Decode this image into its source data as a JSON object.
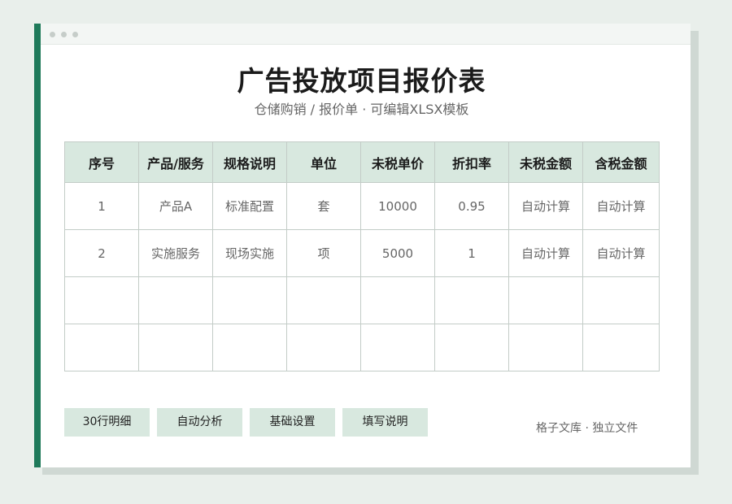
{
  "document": {
    "title": "广告投放项目报价表",
    "subtitle": "仓储购销 / 报价单 · 可编辑XLSX模板"
  },
  "table": {
    "headers": [
      "序号",
      "产品/服务",
      "规格说明",
      "单位",
      "未税单价",
      "折扣率",
      "未税金额",
      "含税金额"
    ],
    "rows": [
      [
        "1",
        "产品A",
        "标准配置",
        "套",
        "10000",
        "0.95",
        "自动计算",
        "自动计算"
      ],
      [
        "2",
        "实施服务",
        "现场实施",
        "项",
        "5000",
        "1",
        "自动计算",
        "自动计算"
      ],
      [
        "",
        "",
        "",
        "",
        "",
        "",
        "",
        ""
      ],
      [
        "",
        "",
        "",
        "",
        "",
        "",
        "",
        ""
      ]
    ]
  },
  "buttons": [
    "30行明细",
    "自动分析",
    "基础设置",
    "填写说明"
  ],
  "footer": {
    "note": "格子文库 · 独立文件"
  },
  "colors": {
    "background": "#e9efeb",
    "accent": "#1f7a5a",
    "header_fill": "#d8e8df",
    "button_fill": "#d8e8df",
    "grid_line": "#c3ccc7"
  }
}
